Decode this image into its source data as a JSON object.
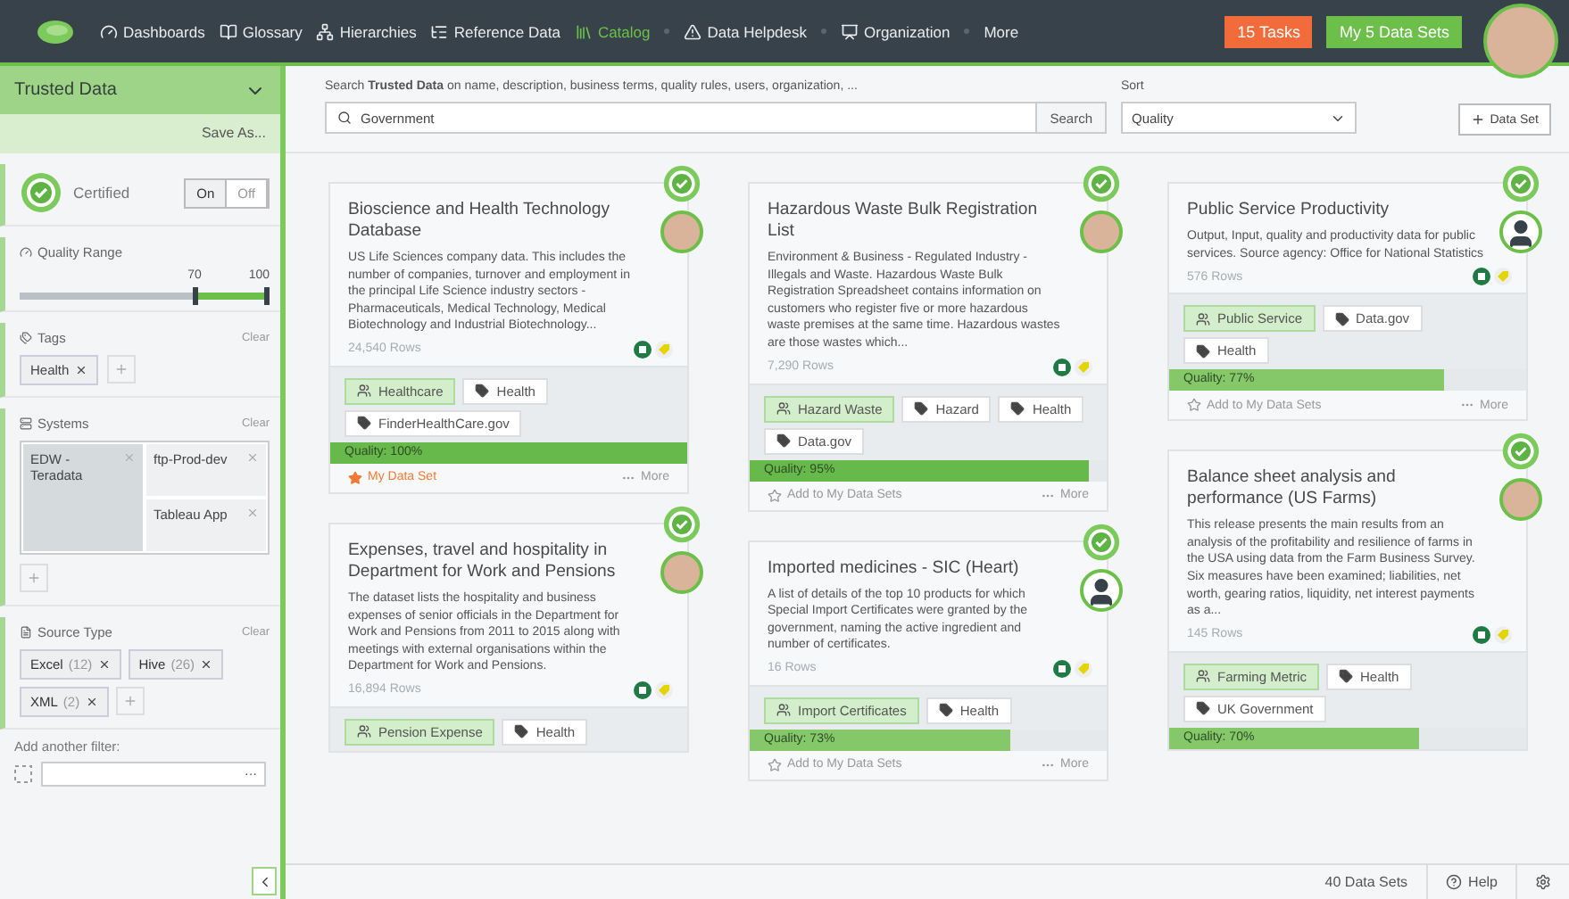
{
  "nav": {
    "items": [
      {
        "label": "Dashboards",
        "selected": false
      },
      {
        "label": "Glossary",
        "selected": false
      },
      {
        "label": "Hierarchies",
        "selected": false
      },
      {
        "label": "Reference Data",
        "selected": false
      },
      {
        "label": "Catalog",
        "selected": true
      },
      {
        "label": "Data Helpdesk",
        "selected": false
      },
      {
        "label": "Organization",
        "selected": false
      },
      {
        "label": "More",
        "selected": false
      }
    ],
    "tasks": "15 Tasks",
    "my_sets": "My 5 Data Sets"
  },
  "sidebar": {
    "title": "Trusted Data",
    "save_as": "Save As...",
    "certified": {
      "label": "Certified",
      "options": [
        {
          "label": "On",
          "selected": true
        },
        {
          "label": "Off",
          "selected": false
        }
      ]
    },
    "quality_range": {
      "label": "Quality Range",
      "handles": [
        {
          "label": "70",
          "level": 0.7
        },
        {
          "label": "100",
          "level": 1.0
        }
      ]
    },
    "tags": {
      "label": "Tags",
      "clear": "Clear",
      "chips": [
        {
          "name": "Health"
        }
      ]
    },
    "systems": {
      "label": "Systems",
      "clear": "Clear",
      "items": [
        {
          "name": "EDW - Teradata",
          "selected": true
        },
        {
          "name": "ftp-Prod-dev",
          "selected": false
        },
        {
          "name": "Tableau App",
          "selected": false
        }
      ]
    },
    "source_type": {
      "label": "Source Type",
      "clear": "Clear",
      "chips": [
        {
          "name": "Excel",
          "count": "(12)"
        },
        {
          "name": "Hive",
          "count": "(26)"
        },
        {
          "name": "XML",
          "count": "(2)"
        }
      ]
    },
    "add_filter": {
      "label": "Add another filter:",
      "more": "···"
    }
  },
  "search": {
    "hint": "Search **Trusted Data** on name, description, business terms, quality rules, users, organization, ...",
    "value": "Government",
    "button": "Search",
    "sort_label": "Sort",
    "sort_value": "Quality",
    "add_button": "Data Set"
  },
  "columns": [
    {
      "cards": [
        {
          "title": "Bioscience and Health Technology Database",
          "certified": true,
          "owner": {
            "kind": "photo"
          },
          "description": "US Life Sciences company data. This includes the number of companies, turnover and employment in the principal Life Science industry sectors - Pharmaceuticals, Medical Technology, Medical Biotechnology and Industrial Biotechnology...",
          "rows": "24,540 Rows",
          "tags": [
            {
              "kind": "term",
              "label": "Healthcare"
            },
            {
              "kind": "tag",
              "label": "Health"
            },
            {
              "kind": "tag",
              "label": "FinderHealthCare.gov"
            }
          ],
          "quality": {
            "label": "Quality: 100%",
            "level": 1.0
          },
          "favorite": {
            "label": "My Data Set",
            "on": true
          },
          "more": "More"
        },
        {
          "title": "Expenses, travel and hospitality in Department for Work and Pensions",
          "certified": true,
          "owner": {
            "kind": "photo"
          },
          "description": "The dataset lists the hospitality and business expenses of senior officials in the Department for Work and Pensions from 2011 to 2015 along with meetings with external organisations within the Department for Work and Pensions.",
          "rows": "16,894 Rows",
          "tags": [
            {
              "kind": "term",
              "label": "Pension Expense"
            },
            {
              "kind": "tag",
              "label": "Health"
            }
          ]
        }
      ]
    },
    {
      "cards": [
        {
          "title": "Hazardous Waste Bulk Registration List",
          "certified": true,
          "owner": {
            "kind": "photo"
          },
          "description": "Environment & Business - Regulated Industry - Illegals and Waste. Hazardous Waste Bulk Registration Spreadsheet contains information on customers who register five or more hazardous waste premises at the same time. Hazardous wastes are those wastes which...",
          "rows": "7,290 Rows",
          "tags": [
            {
              "kind": "term",
              "label": "Hazard Waste"
            },
            {
              "kind": "tag",
              "label": "Hazard"
            },
            {
              "kind": "tag",
              "label": "Health"
            },
            {
              "kind": "tag",
              "label": "Data.gov"
            }
          ],
          "quality": {
            "label": "Quality: 95%",
            "level": 0.95
          },
          "favorite": {
            "label": "Add to My Data Sets",
            "on": false
          },
          "more": "More"
        },
        {
          "title": "Imported medicines - SIC (Heart)",
          "certified": true,
          "owner": {
            "kind": "silhouette"
          },
          "description": "A list of details of the top 10 products for which Special Import Certificates were granted by the government, naming the active ingredient and number of certificates.",
          "rows": "16 Rows",
          "tags": [
            {
              "kind": "term",
              "label": "Import Certificates"
            },
            {
              "kind": "tag",
              "label": "Health"
            }
          ],
          "quality": {
            "label": "Quality: 73%",
            "level": 0.73
          },
          "favorite": {
            "label": "Add to My Data Sets",
            "on": false
          },
          "more": "More"
        }
      ]
    },
    {
      "cards": [
        {
          "title": "Public Service Productivity",
          "certified": true,
          "owner": {
            "kind": "silhouette"
          },
          "description": "Output, Input, quality and productivity data for public services. Source agency: Office for National Statistics",
          "rows": "576 Rows",
          "tags": [
            {
              "kind": "term",
              "label": "Public Service"
            },
            {
              "kind": "tag",
              "label": "Data.gov"
            },
            {
              "kind": "tag",
              "label": "Health"
            }
          ],
          "quality": {
            "label": "Quality: 77%",
            "level": 0.77
          },
          "favorite": {
            "label": "Add to My Data Sets",
            "on": false
          },
          "more": "More"
        },
        {
          "title": "Balance sheet analysis and performance (US Farms)",
          "certified": true,
          "owner": {
            "kind": "photo"
          },
          "description": "This release presents the main results from an analysis of the profitability and resilience of farms in the USA using data from the Farm Business Survey. Six measures have been examined; liabilities, net worth, gearing ratios, liquidity, net interest payments as a...",
          "rows": "145 Rows",
          "tags": [
            {
              "kind": "term",
              "label": "Farming Metric"
            },
            {
              "kind": "tag",
              "label": "Health"
            },
            {
              "kind": "tag",
              "label": "UK Government"
            }
          ],
          "quality": {
            "label": "Quality: 70%",
            "level": 0.7
          }
        }
      ]
    }
  ],
  "footer": {
    "count": "40 Data Sets",
    "help": "Help"
  }
}
